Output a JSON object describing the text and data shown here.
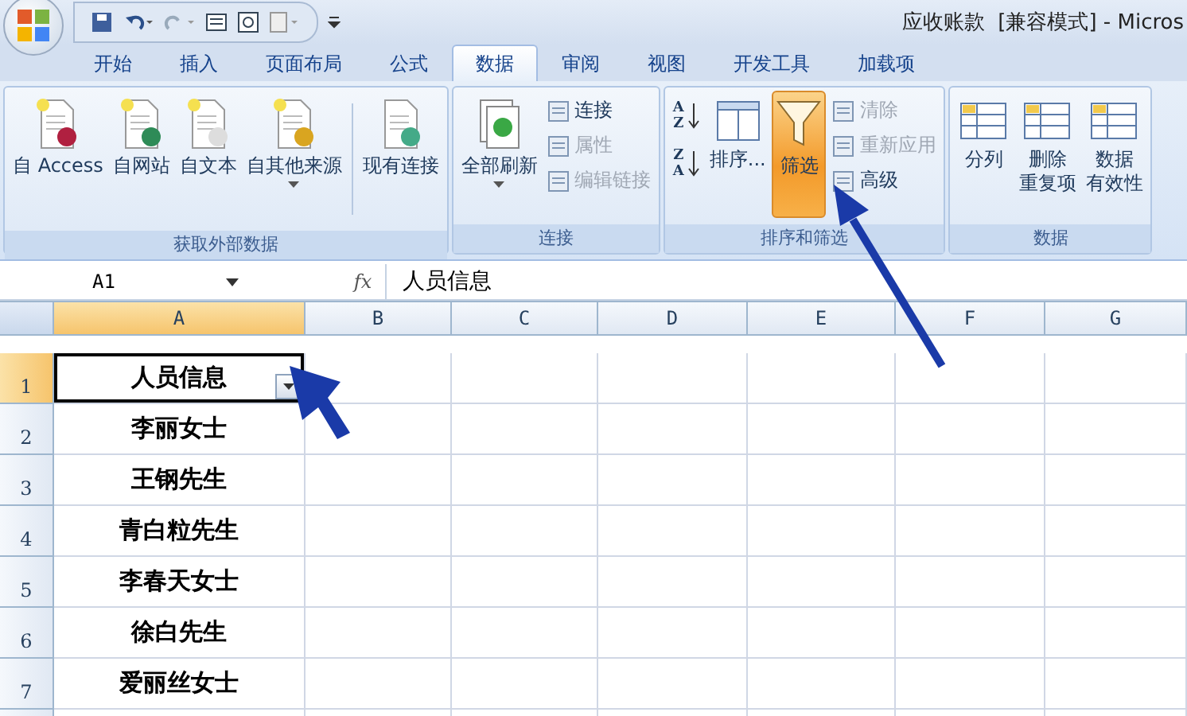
{
  "window": {
    "title": "应收账款  [兼容模式] - Micros"
  },
  "tabs": [
    {
      "label": "开始",
      "selected": false
    },
    {
      "label": "插入",
      "selected": false
    },
    {
      "label": "页面布局",
      "selected": false
    },
    {
      "label": "公式",
      "selected": false
    },
    {
      "label": "数据",
      "selected": true
    },
    {
      "label": "审阅",
      "selected": false
    },
    {
      "label": "视图",
      "selected": false
    },
    {
      "label": "开发工具",
      "selected": false
    },
    {
      "label": "加载项",
      "selected": false
    }
  ],
  "ribbon_groups": [
    {
      "title": "获取外部数据",
      "buttons": [
        {
          "kind": "large",
          "label": "自 Access",
          "has_menu": false,
          "disabled": false,
          "selected": false
        },
        {
          "kind": "large",
          "label": "自网站",
          "has_menu": false,
          "disabled": false,
          "selected": false
        },
        {
          "kind": "large",
          "label": "自文本",
          "has_menu": false,
          "disabled": false,
          "selected": false
        },
        {
          "kind": "large",
          "label": "自其他来源",
          "has_menu": true,
          "disabled": false,
          "selected": false
        },
        {
          "kind": "separator"
        },
        {
          "kind": "large",
          "label": "现有连接",
          "has_menu": false,
          "disabled": false,
          "selected": false
        }
      ]
    },
    {
      "title": "连接",
      "buttons": [
        {
          "kind": "large",
          "label": "全部刷新",
          "has_menu": true,
          "disabled": false,
          "selected": false
        },
        {
          "kind": "small",
          "label": "连接",
          "disabled": false
        },
        {
          "kind": "small",
          "label": "属性",
          "disabled": true
        },
        {
          "kind": "small",
          "label": "编辑链接",
          "disabled": true
        }
      ]
    },
    {
      "title": "排序和筛选",
      "buttons": [
        {
          "kind": "sort_pair",
          "ascending": [
            "A",
            "Z"
          ],
          "descending": [
            "Z",
            "A"
          ]
        },
        {
          "kind": "large",
          "label": "排序...",
          "has_menu": false,
          "disabled": false,
          "selected": false
        },
        {
          "kind": "large",
          "label": "筛选",
          "has_menu": false,
          "disabled": false,
          "selected": true
        },
        {
          "kind": "small",
          "label": "清除",
          "disabled": true
        },
        {
          "kind": "small",
          "label": "重新应用",
          "disabled": true
        },
        {
          "kind": "small",
          "label": "高级",
          "disabled": false
        }
      ]
    },
    {
      "title": "数据",
      "buttons": [
        {
          "kind": "large",
          "label": "分列",
          "has_menu": false,
          "disabled": false,
          "selected": false
        },
        {
          "kind": "large",
          "label": "删除",
          "label_2": "重复项",
          "has_menu": false,
          "disabled": false,
          "selected": false
        },
        {
          "kind": "large",
          "label": "数据",
          "label_2": "有效性",
          "has_menu": false,
          "disabled": false,
          "selected": false
        }
      ]
    }
  ],
  "formula_bar": {
    "name_box": "A1",
    "fx": "fx",
    "formula": "人员信息"
  },
  "columns": [
    {
      "label": "A",
      "selected": true
    },
    {
      "label": "B",
      "selected": false
    },
    {
      "label": "C",
      "selected": false
    },
    {
      "label": "D",
      "selected": false
    },
    {
      "label": "E",
      "selected": false
    },
    {
      "label": "F",
      "selected": false
    },
    {
      "label": "G",
      "selected": false
    }
  ],
  "rows": [
    {
      "number": "1",
      "value": "人员信息",
      "selected": true,
      "filter": true
    },
    {
      "number": "2",
      "value": "李丽女士",
      "selected": false,
      "filter": false
    },
    {
      "number": "3",
      "value": "王钢先生",
      "selected": false,
      "filter": false
    },
    {
      "number": "4",
      "value": "青白粒先生",
      "selected": false,
      "filter": false
    },
    {
      "number": "5",
      "value": "李春天女士",
      "selected": false,
      "filter": false
    },
    {
      "number": "6",
      "value": "徐白先生",
      "selected": false,
      "filter": false
    },
    {
      "number": "7",
      "value": "爱丽丝女士",
      "selected": false,
      "filter": false
    }
  ]
}
